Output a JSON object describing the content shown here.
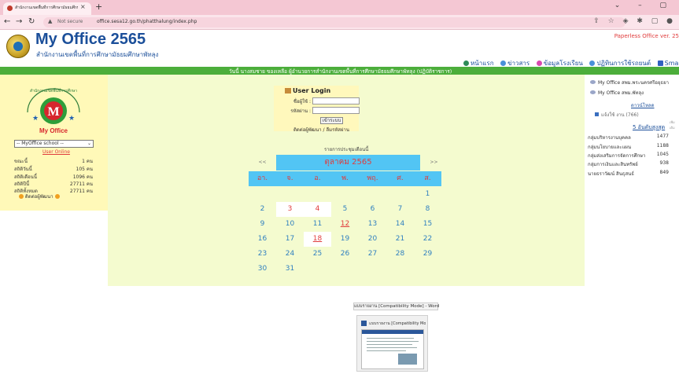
{
  "browser": {
    "tab_title": "สำนักงานเขตพื้นที่การศึกษามัธยมศึกษา...",
    "tab_close": "×",
    "new_tab": "+",
    "window_controls": "⌄ – ▢",
    "not_secure": "Not secure",
    "url": "office.sesa12.go.th/phatthalung/index.php"
  },
  "header": {
    "title": "My Office 2565",
    "subtitle": "สำนักงานเขตพื้นที่การศึกษามัธยมศึกษาพัทลุง",
    "paperless": "Paperless Office ver. 25",
    "menu": [
      {
        "label": "หน้าแรก",
        "color": "#2e8b57"
      },
      {
        "label": "ข่าวสาร",
        "color": "#4a90d9"
      },
      {
        "label": "ข้อมูลโรงเรียน",
        "color": "#d94ab0"
      },
      {
        "label": "ปฏิทินการใช้รถยนต์",
        "color": "#4a90d9"
      },
      {
        "label": "Smart Ob",
        "color": "#3060c0"
      }
    ]
  },
  "marquee": "วันนี้ นางสมชาย ของเหลือ ผู้อำนวยการสำนักงานเขตพื้นที่การศึกษามัธยมศึกษาพัทลุง (ปฏิบัติราชการ)",
  "left": {
    "emblem_text": "My Office",
    "school_select": "-- MyOffice school --",
    "user_online": "User Online",
    "stats": [
      {
        "label": "ขณะนี้",
        "value": "1 คน"
      },
      {
        "label": "สถิติวันนี้",
        "value": "105 คน"
      },
      {
        "label": "สถิติเดือนนี้",
        "value": "1096 คน"
      },
      {
        "label": "สถิติปีนี้",
        "value": "27711 คน"
      },
      {
        "label": "สถิติทั้งหมด",
        "value": "27711 คน"
      }
    ],
    "contact": "ติดต่อผู้พัฒนา"
  },
  "login": {
    "title": "User Login",
    "username_label": "ชื่อผู้ใช้ :",
    "password_label": "รหัสผ่าน :",
    "button": "เข้าระบบ",
    "links": "ติดต่อผู้พัฒนา / ลืมรหัสผ่าน"
  },
  "calendar": {
    "caption": "รายการประชุมเดือนนี้",
    "prev": "<<",
    "next": ">>",
    "month": "ตุลาคม 2565",
    "weekdays": [
      "อา.",
      "จ.",
      "อ.",
      "พ.",
      "พฤ.",
      "ศ.",
      "ส."
    ],
    "weeks": [
      [
        "",
        "",
        "",
        "",
        "",
        "",
        "1"
      ],
      [
        "2",
        "3",
        "4",
        "5",
        "6",
        "7",
        "8"
      ],
      [
        "9",
        "10",
        "11",
        "12",
        "13",
        "14",
        "15"
      ],
      [
        "16",
        "17",
        "18",
        "19",
        "20",
        "21",
        "22"
      ],
      [
        "23",
        "24",
        "25",
        "26",
        "27",
        "28",
        "29"
      ],
      [
        "30",
        "31",
        "",
        "",
        "",
        "",
        ""
      ]
    ],
    "highlighted": [
      "3",
      "4",
      "18"
    ],
    "holiday": [
      "12",
      "18"
    ]
  },
  "right": {
    "links": [
      "My Office สพม.พระนครศรีอยุธยา",
      "My Office สพม.พัทลุง"
    ],
    "all_link": "ดาวน์โหลด",
    "visits": "แจ้งใช้ งาน (766)",
    "more": "เพิ่มเติม",
    "heading": "5 อันดับสูงสุด",
    "groups": [
      {
        "label": "กลุ่มบริหารงานบุคคล",
        "value": "1477"
      },
      {
        "label": "กลุ่มนโยบายและแผน",
        "value": "1188"
      },
      {
        "label": "กลุ่มส่งเสริมการจัดการศึกษา",
        "value": "1045"
      },
      {
        "label": "กลุ่มการเงินและสินทรัพย์",
        "value": "938"
      },
      {
        "label": "นายธราวัฒน์ สินธุสนธ์",
        "value": "849"
      }
    ]
  },
  "preview": {
    "tooltip": "แบบรายงาน [Compatibility Mode] - Word",
    "title": "แบบรายงาน [Compatibility Mode]..."
  }
}
